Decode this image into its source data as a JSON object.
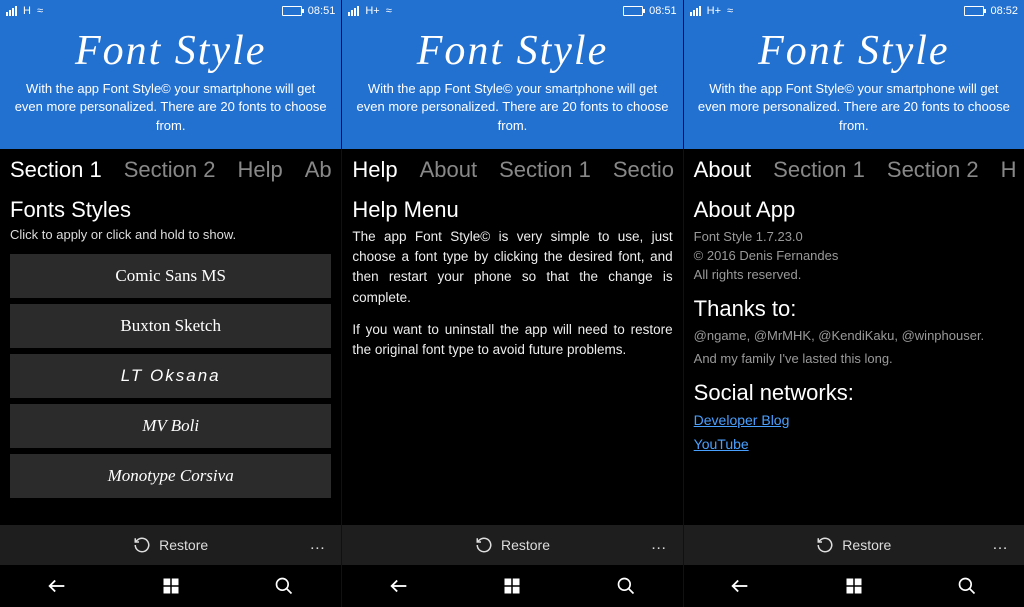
{
  "statusbar": {
    "network1": "H",
    "network2": "H+",
    "network3": "H+",
    "time1": "08:51",
    "time2": "08:51",
    "time3": "08:52"
  },
  "header": {
    "title": "Font Style",
    "description": "With the app Font Style© your smartphone will get even more personalized. There are 20 fonts to choose from."
  },
  "screen1": {
    "tabs": [
      "Section 1",
      "Section 2",
      "Help",
      "Ab"
    ],
    "activeTab": 0,
    "title": "Fonts Styles",
    "subtitle": "Click to apply or click and hold to show.",
    "fonts": [
      "Comic Sans MS",
      "Buxton Sketch",
      "LT Oksana",
      "MV Boli",
      "Monotype Corsiva"
    ]
  },
  "screen2": {
    "tabs": [
      "Help",
      "About",
      "Section 1",
      "Sectio"
    ],
    "activeTab": 0,
    "title": "Help Menu",
    "para1": "The app Font Style© is very simple to use, just choose a font type by clicking the desired font, and then restart your phone so that the change is complete.",
    "para2": "If you want to uninstall the app will need to restore the original font type to avoid future problems."
  },
  "screen3": {
    "tabs": [
      "About",
      "Section 1",
      "Section 2",
      "H"
    ],
    "activeTab": 0,
    "titleApp": "About App",
    "version": "Font Style 1.7.23.0",
    "copyright": "© 2016 Denis Fernandes",
    "rights": "All rights reserved.",
    "thanksTitle": "Thanks to:",
    "thanks1": "@ngame, @MrMHK, @KendiKaku, @winphouser.",
    "thanks2": "And my family I've lasted this long.",
    "socialTitle": "Social networks:",
    "link1": "Developer Blog",
    "link2": "YouTube"
  },
  "appbar": {
    "restore": "Restore",
    "more": "…"
  }
}
